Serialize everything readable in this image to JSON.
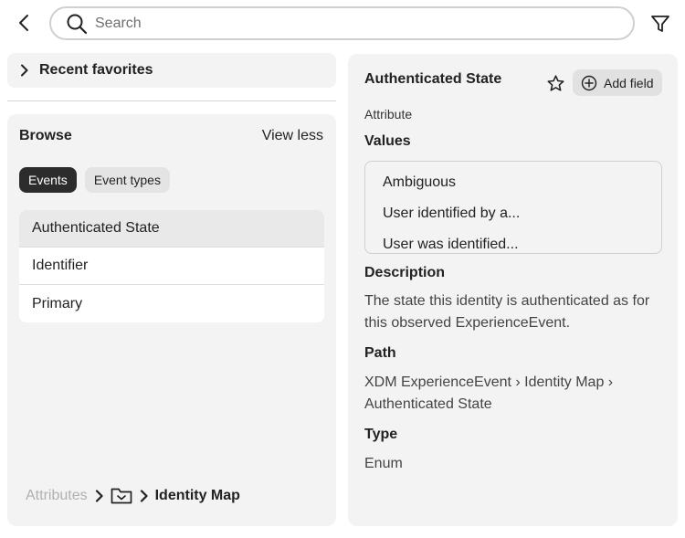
{
  "header": {
    "search_placeholder": "Search",
    "icons": {
      "back": "chevron-left-icon",
      "search": "search-icon",
      "filter": "filter-icon"
    }
  },
  "recent_favorites": {
    "label": "Recent favorites"
  },
  "browse": {
    "title": "Browse",
    "view_less": "View less",
    "tabs": [
      {
        "label": "Events",
        "active": true
      },
      {
        "label": "Event types",
        "active": false
      }
    ],
    "items": [
      {
        "label": "Authenticated State",
        "selected": true
      },
      {
        "label": "Identifier",
        "selected": false
      },
      {
        "label": "Primary",
        "selected": false
      }
    ],
    "breadcrumb": {
      "root": "Attributes",
      "current": "Identity Map"
    }
  },
  "detail": {
    "title": "Authenticated State",
    "add_field": "Add field",
    "subtitle": "Attribute",
    "values_heading": "Values",
    "values": [
      "Ambiguous",
      "User identified by a...",
      "User was identified..."
    ],
    "description_heading": "Description",
    "description": "The state this identity is authenticated as for this observed ExperienceEvent.",
    "path_heading": "Path",
    "path": "XDM ExperienceEvent › Identity Map › Authenticated State",
    "type_heading": "Type",
    "type": "Enum"
  },
  "colors": {
    "panel_bg": "#f3f3f3",
    "active_tab_bg": "#2c2c2c",
    "muted_text": "#b0b0b0"
  }
}
